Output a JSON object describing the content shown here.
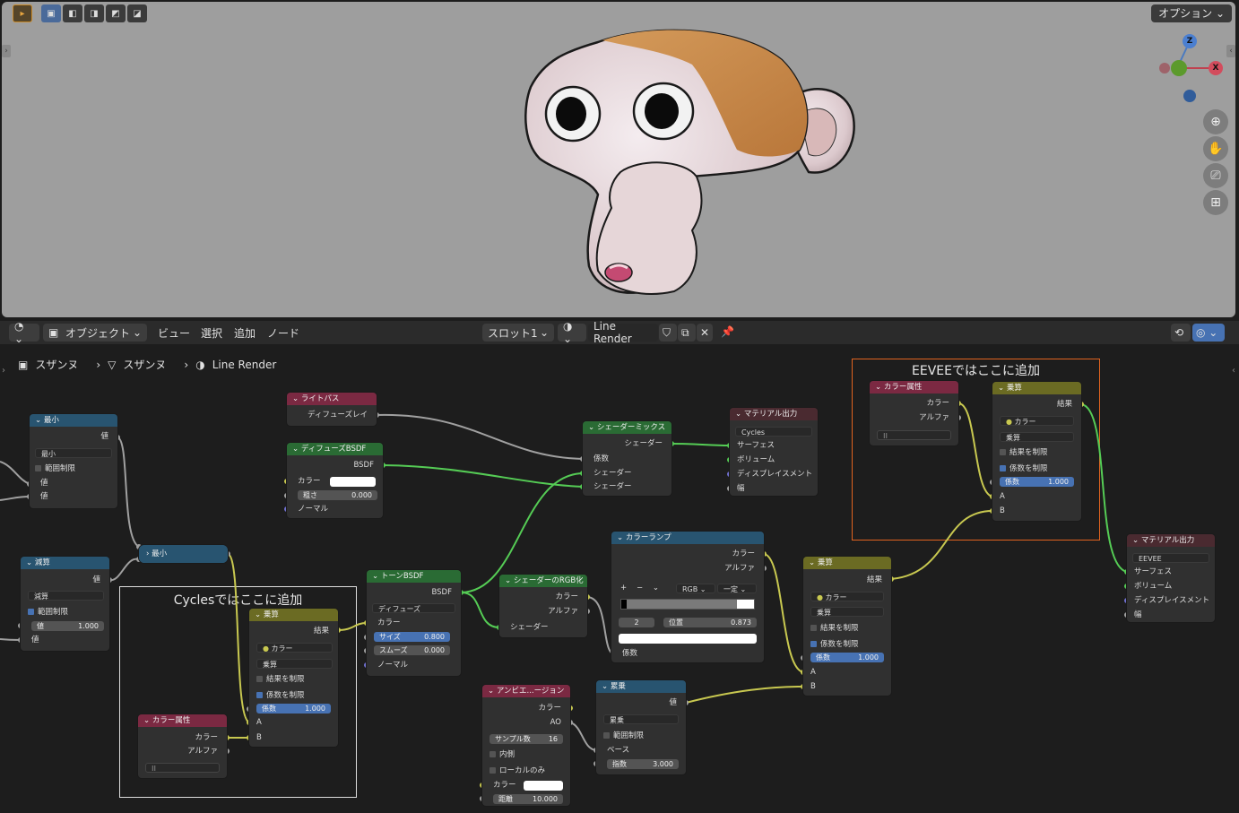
{
  "viewport": {
    "option_label": "オプション",
    "gizmo": {
      "z": "Z",
      "x": "X"
    }
  },
  "header": {
    "mode_label": "オブジェクト",
    "menus": [
      "ビュー",
      "選択",
      "追加",
      "ノード"
    ],
    "slot_label": "スロット1",
    "material_name": "Line Render"
  },
  "breadcrumb": {
    "object": "スザンヌ",
    "mesh": "スザンヌ",
    "material": "Line Render"
  },
  "frames": {
    "cycles": "Cyclesではここに追加",
    "eevee": "EEVEEではここに追加"
  },
  "nodes": {
    "min1": {
      "title": "最小",
      "out": "値",
      "op": "最小",
      "clamp": "範囲制限",
      "in1": "値",
      "in2": "値"
    },
    "sub": {
      "title": "減算",
      "out": "値",
      "op": "減算",
      "clamp": "範囲制限",
      "val_label": "値",
      "val": "1.000",
      "in": "値"
    },
    "min2": {
      "title": "最小"
    },
    "light_path": {
      "title": "ライトパス",
      "out": "ディフューズレイ"
    },
    "diffuse": {
      "title": "ディフューズBSDF",
      "out": "BSDF",
      "color": "カラー",
      "rough_label": "粗さ",
      "rough": "0.000",
      "normal": "ノーマル"
    },
    "toon": {
      "title": "トーンBSDF",
      "out": "BSDF",
      "mode": "ディフューズ",
      "color": "カラー",
      "size_label": "サイズ",
      "size": "0.800",
      "smooth_label": "スムーズ",
      "smooth": "0.000",
      "normal": "ノーマル"
    },
    "mult_c": {
      "title": "乗算",
      "out": "結果",
      "type": "カラー",
      "blend": "乗算",
      "clamp_res": "結果を制限",
      "clamp_fac": "係数を制限",
      "fac_label": "係数",
      "fac": "1.000",
      "a": "A",
      "b": "B"
    },
    "attr_c": {
      "title": "カラー属性",
      "color": "カラー",
      "alpha": "アルファ"
    },
    "mix_shader": {
      "title": "シェーダーミックス",
      "out": "シェーダー",
      "fac": "係数",
      "s1": "シェーダー",
      "s2": "シェーダー"
    },
    "shader_rgb": {
      "title": "シェーダーのRGB化",
      "color": "カラー",
      "alpha": "アルファ",
      "in": "シェーダー"
    },
    "ao": {
      "title": "アンビエ...ージョン",
      "color": "カラー",
      "ao": "AO",
      "samples_label": "サンプル数",
      "samples": "16",
      "inside": "内側",
      "local": "ローカルのみ",
      "in_color": "カラー",
      "dist_label": "距離",
      "dist": "10.000"
    },
    "ramp": {
      "title": "カラーランプ",
      "color": "カラー",
      "alpha": "アルファ",
      "plus": "+",
      "minus": "−",
      "mode": "RGB",
      "interp": "一定",
      "index": "2",
      "pos_label": "位置",
      "pos": "0.873",
      "fac": "係数"
    },
    "power": {
      "title": "累乗",
      "out": "値",
      "op": "累乗",
      "clamp": "範囲制限",
      "base": "ベース",
      "exp_label": "指数",
      "exp": "3.000"
    },
    "mat_out_c": {
      "title": "マテリアル出力",
      "target": "Cycles",
      "surface": "サーフェス",
      "volume": "ボリューム",
      "disp": "ディスプレイスメント",
      "thickness": "幅"
    },
    "mult_m": {
      "title": "乗算",
      "out": "結果",
      "type": "カラー",
      "blend": "乗算",
      "clamp_res": "結果を制限",
      "clamp_fac": "係数を制限",
      "fac_label": "係数",
      "fac": "1.000",
      "a": "A",
      "b": "B"
    },
    "attr_e": {
      "title": "カラー属性",
      "color": "カラー",
      "alpha": "アルファ"
    },
    "mult_e": {
      "title": "乗算",
      "out": "結果",
      "type": "カラー",
      "blend": "乗算",
      "clamp_res": "結果を制限",
      "clamp_fac": "係数を制限",
      "fac_label": "係数",
      "fac": "1.000",
      "a": "A",
      "b": "B"
    },
    "mat_out_e": {
      "title": "マテリアル出力",
      "target": "EEVEE",
      "surface": "サーフェス",
      "volume": "ボリューム",
      "disp": "ディスプレイスメント",
      "thickness": "幅"
    }
  }
}
